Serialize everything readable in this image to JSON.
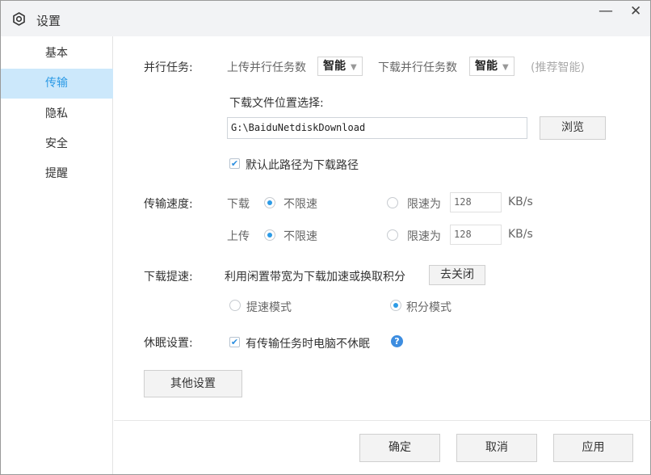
{
  "window": {
    "title": "设置",
    "minimize": "—",
    "close": "✕"
  },
  "sidebar": {
    "items": [
      {
        "label": "基本"
      },
      {
        "label": "传输"
      },
      {
        "label": "隐私"
      },
      {
        "label": "安全"
      },
      {
        "label": "提醒"
      }
    ],
    "active": "传输"
  },
  "parallel": {
    "label": "并行任务:",
    "upload_label": "上传并行任务数",
    "upload_value": "智能",
    "download_label": "下载并行任务数",
    "download_value": "智能",
    "hint": "(推荐智能)"
  },
  "location": {
    "label": "下载文件位置选择:",
    "path": "G:\\BaiduNetdiskDownload",
    "browse": "浏览",
    "default_checkbox": "默认此路径为下载路径",
    "default_checked": true
  },
  "speed": {
    "label": "传输速度:",
    "download": {
      "label": "下载",
      "unlimited": "不限速",
      "limit": "限速为",
      "value": "128",
      "unit": "KB/s",
      "selected": "unlimited"
    },
    "upload": {
      "label": "上传",
      "unlimited": "不限速",
      "limit": "限速为",
      "value": "128",
      "unit": "KB/s",
      "selected": "unlimited"
    }
  },
  "boost": {
    "label": "下载提速:",
    "desc": "利用闲置带宽为下载加速或换取积分",
    "close_btn": "去关闭",
    "mode_speed": "提速模式",
    "mode_points": "积分模式",
    "selected": "points"
  },
  "sleep": {
    "label": "休眠设置:",
    "checkbox": "有传输任务时电脑不休眠",
    "checked": true
  },
  "other_btn": "其他设置",
  "footer": {
    "ok": "确定",
    "cancel": "取消",
    "apply": "应用"
  },
  "colors": {
    "accent": "#2d9be6",
    "sidebar_active_bg": "#cce8fb"
  }
}
